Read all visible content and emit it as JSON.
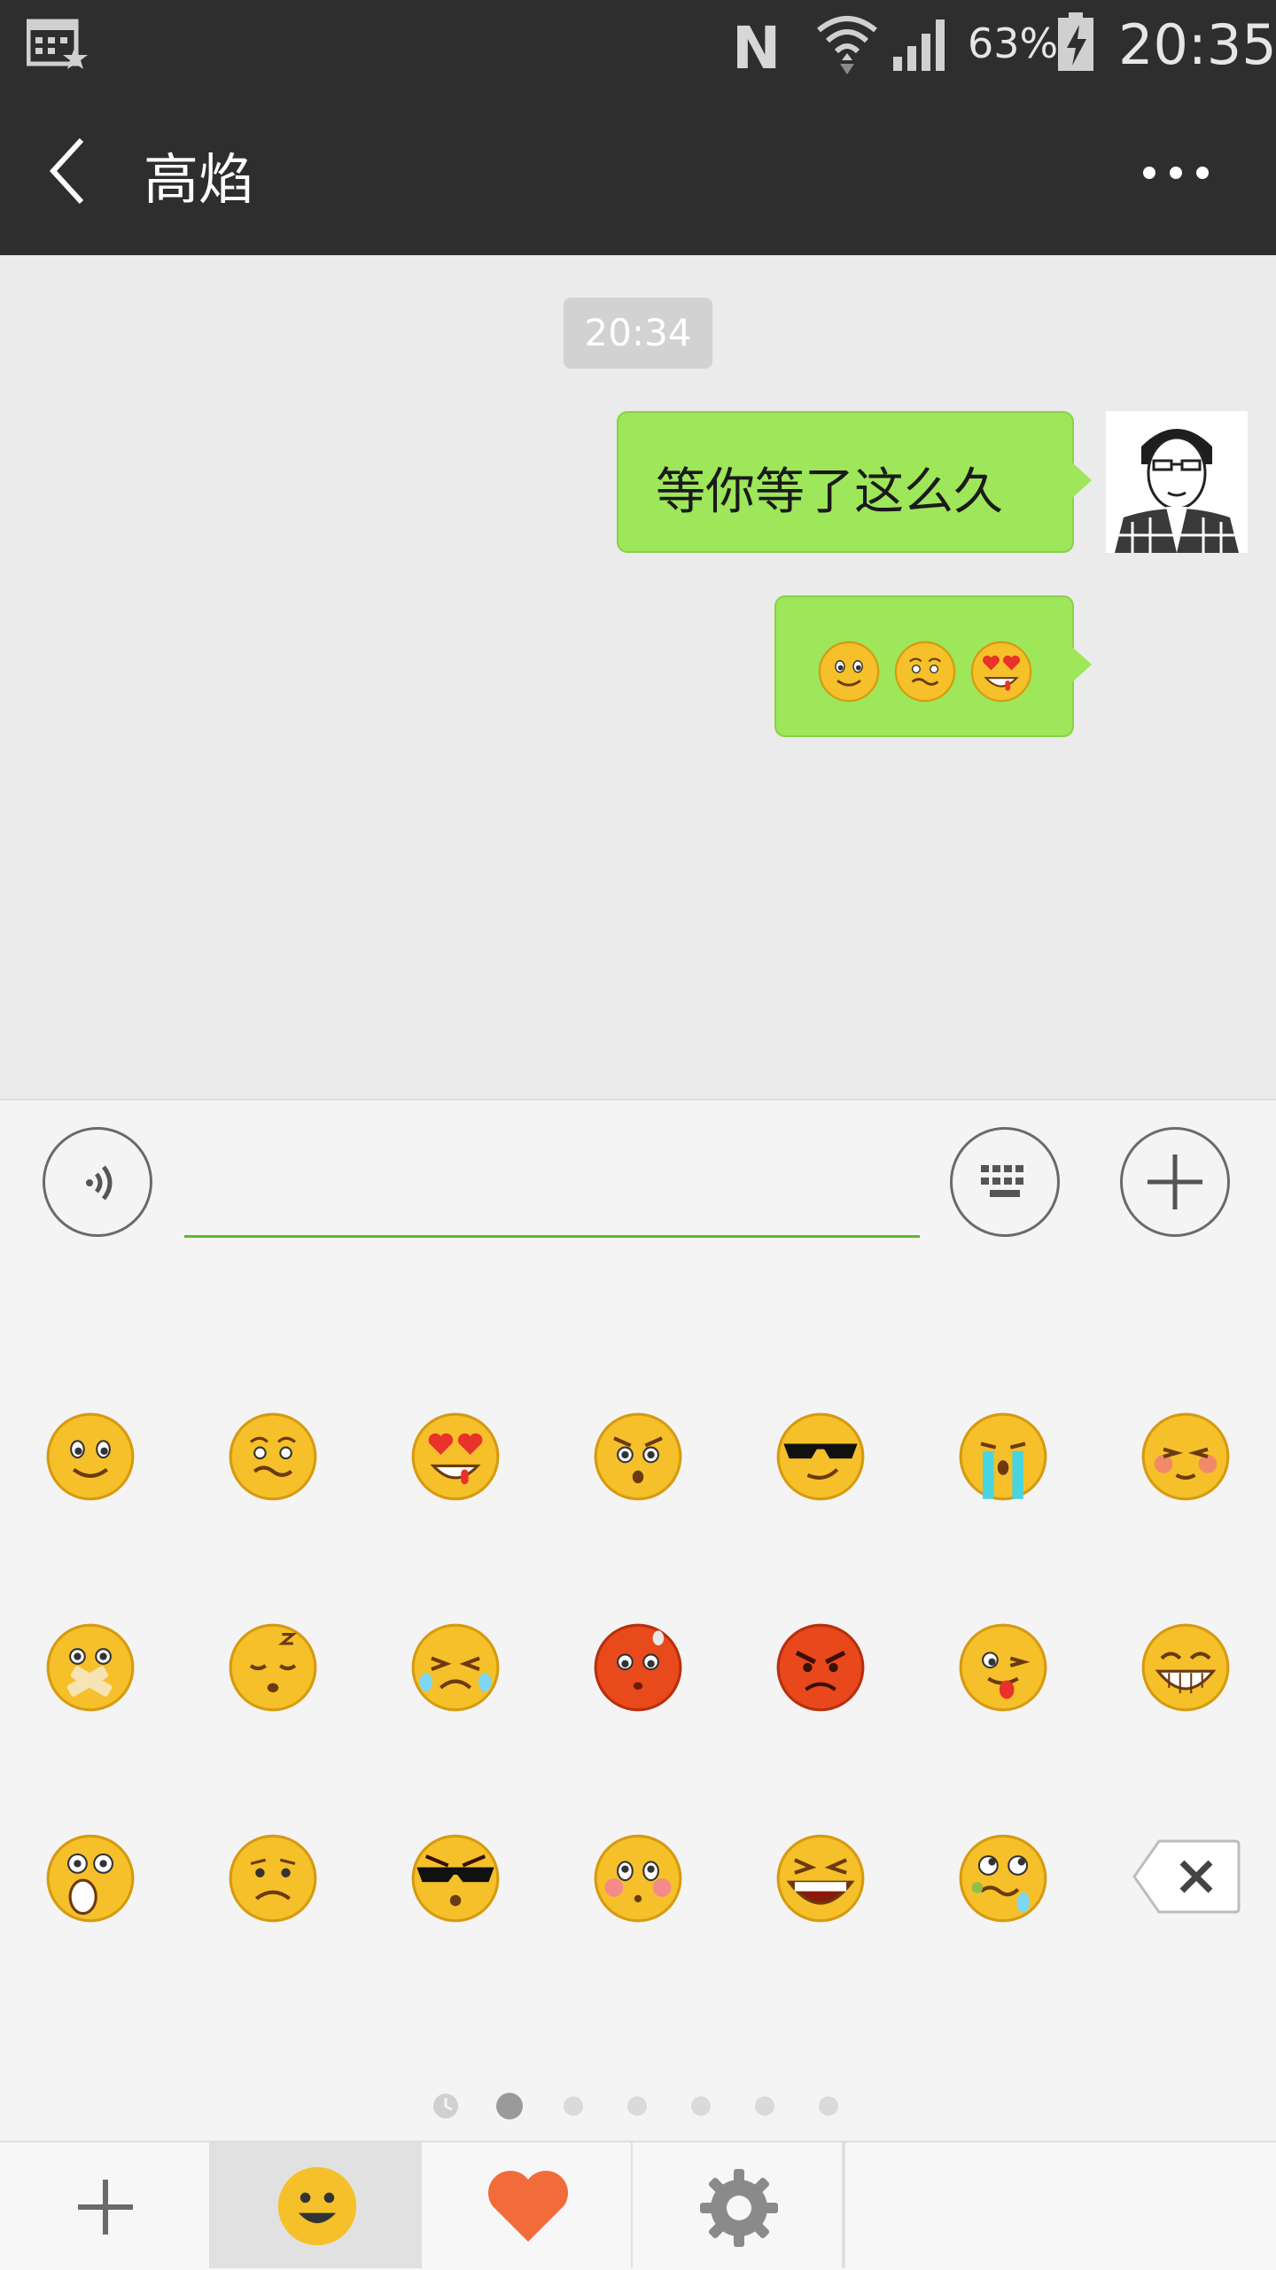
{
  "status_bar": {
    "battery_percent": "63%",
    "time": "20:35",
    "icons": [
      "calendar-star-icon",
      "nfc-n-icon",
      "wifi-icon",
      "cell-signal-icon",
      "battery-charging-icon"
    ]
  },
  "header": {
    "title": "高焰",
    "back_icon": "chevron-left-icon",
    "more_icon": "more-dots-icon"
  },
  "chat": {
    "timestamp": "20:34",
    "messages": [
      {
        "from": "me",
        "type": "text",
        "text": "等你等了这么久"
      },
      {
        "from": "me",
        "type": "emoji",
        "emojis": [
          "smile",
          "awkward",
          "love-eyes"
        ]
      }
    ]
  },
  "input_bar": {
    "voice_icon": "voice-icon",
    "keyboard_icon": "keyboard-icon",
    "plus_icon": "plus-icon",
    "text_value": ""
  },
  "emoji_panel": {
    "rows": [
      [
        "smile",
        "awkward",
        "love-eyes",
        "stare",
        "cool-sunglasses",
        "crying",
        "shy"
      ],
      [
        "shut-mouth",
        "sleepy",
        "tearful",
        "embarrassed",
        "angry",
        "tongue-wink",
        "grin"
      ],
      [
        "surprised",
        "sad",
        "cool-mask",
        "blush",
        "scream",
        "drooling"
      ]
    ],
    "delete_icon": "backspace-icon",
    "page_count": 7,
    "active_page": 1
  },
  "bottom_bar": {
    "tabs": [
      "plus-icon",
      "smiley-icon",
      "heart-icon",
      "gear-icon"
    ],
    "selected_tab": 1
  },
  "colors": {
    "bar_dark": "#2e2e2e",
    "bubble_green": "#9ee65a",
    "input_underline": "#5cb82a",
    "emoji_yellow": "#f5c02a",
    "heart_orange": "#f26b3a"
  }
}
